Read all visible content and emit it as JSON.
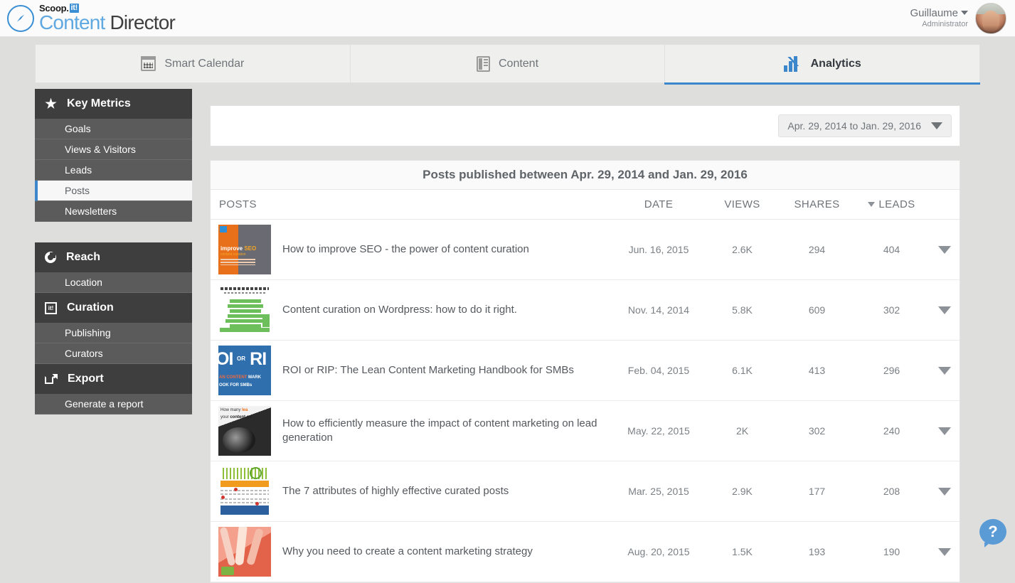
{
  "header": {
    "brand": {
      "scoop": "Scoop.",
      "it": "it!",
      "content": "Content",
      "director": "Director"
    },
    "user": {
      "name": "Guillaume",
      "role": "Administrator",
      "avatar_icon": "user-avatar"
    }
  },
  "tabs": [
    {
      "label": "Smart Calendar",
      "icon": "calendar-icon",
      "active": false
    },
    {
      "label": "Content",
      "icon": "content-icon",
      "active": false
    },
    {
      "label": "Analytics",
      "icon": "analytics-bar-chart-icon",
      "active": true
    }
  ],
  "sidebar": {
    "groups": [
      {
        "title": "Key Metrics",
        "icon": "star-icon",
        "items": [
          {
            "label": "Goals",
            "active": false
          },
          {
            "label": "Views & Visitors",
            "active": false
          },
          {
            "label": "Leads",
            "active": false
          },
          {
            "label": "Posts",
            "active": true
          },
          {
            "label": "Newsletters",
            "active": false
          }
        ]
      },
      {
        "title": "Reach",
        "icon": "reach-circle-icon",
        "items": [
          {
            "label": "Location",
            "active": false
          }
        ]
      },
      {
        "title": "Curation",
        "icon": "curation-scoopit-icon",
        "items": [
          {
            "label": "Publishing",
            "active": false
          },
          {
            "label": "Curators",
            "active": false
          }
        ]
      },
      {
        "title": "Export",
        "icon": "export-icon",
        "items": [
          {
            "label": "Generate a report",
            "active": false
          }
        ]
      }
    ]
  },
  "daterange": {
    "label": "Apr. 29, 2014 to Jan. 29, 2016",
    "caret_icon": "chevron-down-icon"
  },
  "table": {
    "title": "Posts published between Apr. 29, 2014 and Jan. 29, 2016",
    "columns": {
      "posts": "POSTS",
      "date": "DATE",
      "views": "VIEWS",
      "shares": "SHARES",
      "leads": "LEADS"
    },
    "sorted_by": "LEADS",
    "sort_direction": "desc",
    "rows": [
      {
        "title": "How to improve SEO - the power of content curation",
        "date": "Jun. 16, 2015",
        "views": "2.6K",
        "shares": "294",
        "leads": "404",
        "thumb": "thumb-improve-seo"
      },
      {
        "title": "Content curation on Wordpress: how to do it right.",
        "date": "Nov. 14, 2014",
        "views": "5.8K",
        "shares": "609",
        "leads": "302",
        "thumb": "thumb-wordpress-chart"
      },
      {
        "title": "ROI or RIP: The Lean Content Marketing Handbook for SMBs",
        "date": "Feb. 04, 2015",
        "views": "6.1K",
        "shares": "413",
        "leads": "296",
        "thumb": "thumb-roi-or-rip"
      },
      {
        "title": "How to efficiently measure the impact of content marketing on lead generation",
        "date": "May. 22, 2015",
        "views": "2K",
        "shares": "302",
        "leads": "240",
        "thumb": "thumb-lead-generation"
      },
      {
        "title": "The 7 attributes of highly effective curated posts",
        "date": "Mar. 25, 2015",
        "views": "2.9K",
        "shares": "177",
        "leads": "208",
        "thumb": "thumb-seven-attributes"
      },
      {
        "title": "Why you need to create a content marketing strategy",
        "date": "Aug. 20, 2015",
        "views": "1.5K",
        "shares": "193",
        "leads": "190",
        "thumb": "thumb-why-strategy"
      }
    ]
  },
  "help": {
    "label": "?",
    "icon": "help-chat-icon"
  },
  "colors": {
    "accent": "#3c86cc",
    "sidebar_header": "#3e3e3e",
    "sidebar_item": "#5b5b5b",
    "page_bg": "#dededd",
    "help_blue": "#5b9bd5"
  }
}
